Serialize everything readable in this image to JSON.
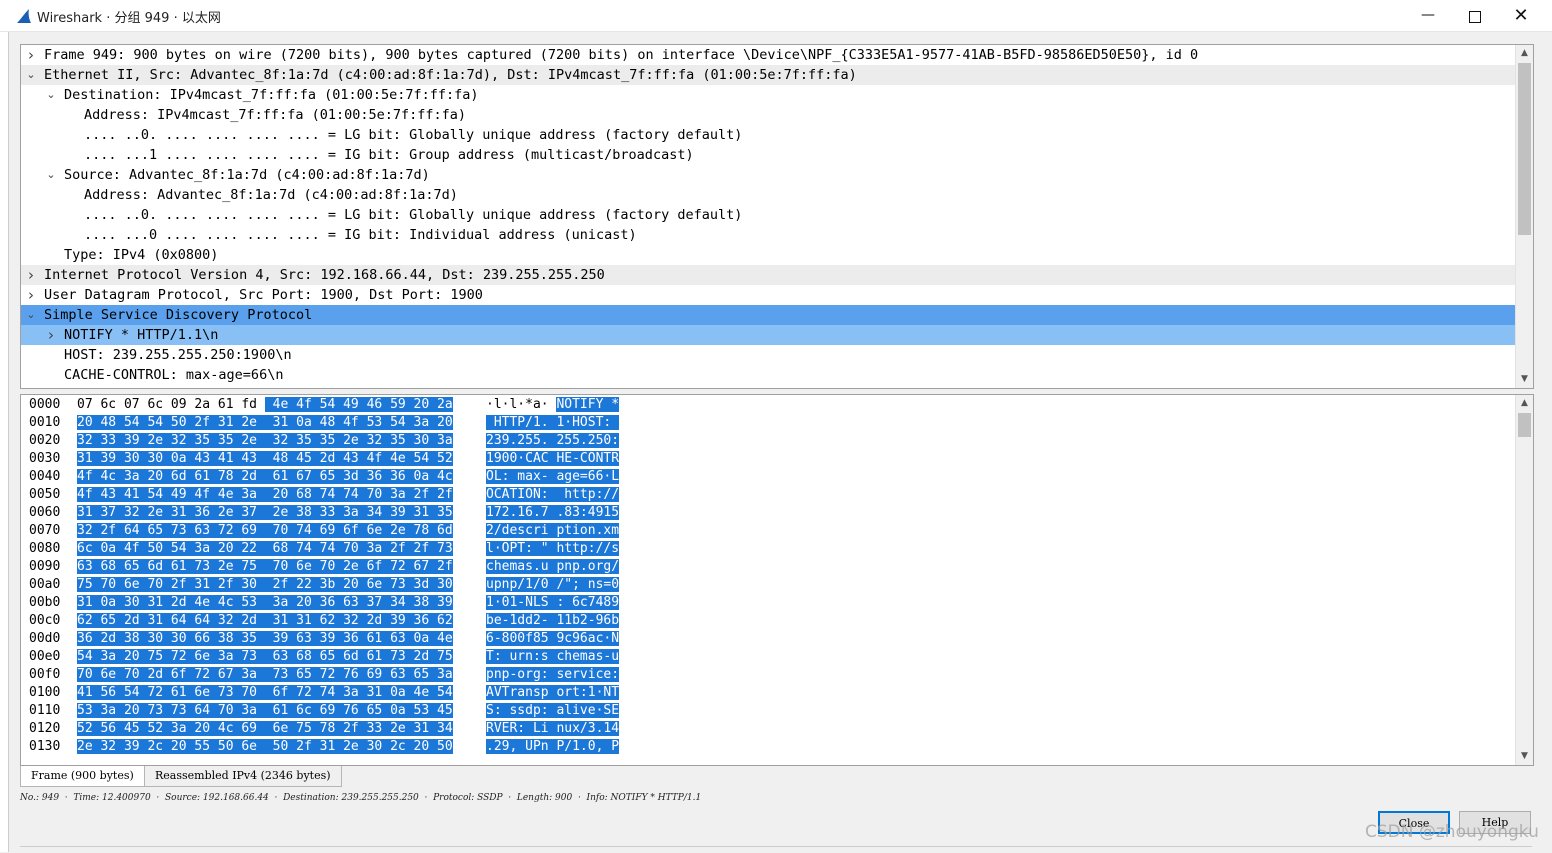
{
  "window": {
    "title": "Wireshark · 分组 949 · 以太网",
    "minimize": "—",
    "close": "✕"
  },
  "tree": {
    "rows": [
      {
        "indent": 0,
        "arrow": "right",
        "text": "Frame 949: 900 bytes on wire (7200 bits), 900 bytes captured (7200 bits) on interface \\Device\\NPF_{C333E5A1-9577-41AB-B5FD-98586ED50E50}, id 0",
        "style": ""
      },
      {
        "indent": 0,
        "arrow": "down",
        "text": "Ethernet II, Src: Advantec_8f:1a:7d (c4:00:ad:8f:1a:7d), Dst: IPv4mcast_7f:ff:fa (01:00:5e:7f:ff:fa)",
        "style": "shade"
      },
      {
        "indent": 1,
        "arrow": "down",
        "text": "Destination: IPv4mcast_7f:ff:fa (01:00:5e:7f:ff:fa)",
        "style": ""
      },
      {
        "indent": 2,
        "arrow": "",
        "text": "Address: IPv4mcast_7f:ff:fa (01:00:5e:7f:ff:fa)",
        "style": ""
      },
      {
        "indent": 2,
        "arrow": "",
        "text": ".... ..0. .... .... .... .... = LG bit: Globally unique address (factory default)",
        "style": ""
      },
      {
        "indent": 2,
        "arrow": "",
        "text": ".... ...1 .... .... .... .... = IG bit: Group address (multicast/broadcast)",
        "style": ""
      },
      {
        "indent": 1,
        "arrow": "down",
        "text": "Source: Advantec_8f:1a:7d (c4:00:ad:8f:1a:7d)",
        "style": ""
      },
      {
        "indent": 2,
        "arrow": "",
        "text": "Address: Advantec_8f:1a:7d (c4:00:ad:8f:1a:7d)",
        "style": ""
      },
      {
        "indent": 2,
        "arrow": "",
        "text": ".... ..0. .... .... .... .... = LG bit: Globally unique address (factory default)",
        "style": ""
      },
      {
        "indent": 2,
        "arrow": "",
        "text": ".... ...0 .... .... .... .... = IG bit: Individual address (unicast)",
        "style": ""
      },
      {
        "indent": 1,
        "arrow": "",
        "text": "Type: IPv4 (0x0800)",
        "style": ""
      },
      {
        "indent": 0,
        "arrow": "right",
        "text": "Internet Protocol Version 4, Src: 192.168.66.44, Dst: 239.255.255.250",
        "style": "shade"
      },
      {
        "indent": 0,
        "arrow": "right",
        "text": "User Datagram Protocol, Src Port: 1900, Dst Port: 1900",
        "style": ""
      },
      {
        "indent": 0,
        "arrow": "down",
        "text": "Simple Service Discovery Protocol",
        "style": "sel"
      },
      {
        "indent": 1,
        "arrow": "right",
        "text": "NOTIFY * HTTP/1.1\\n",
        "style": "sel2"
      },
      {
        "indent": 1,
        "arrow": "",
        "text": "HOST: 239.255.255.250:1900\\n",
        "style": ""
      },
      {
        "indent": 1,
        "arrow": "",
        "text": "CACHE-CONTROL: max-age=66\\n",
        "style": ""
      }
    ]
  },
  "bytes": {
    "rows": [
      {
        "off": "0000",
        "hex": "07 6c 07 6c 09 2a 61 fd  4e 4f 54 49 46 59 20 2a",
        "ascii": "·l·l·*a· NOTIFY *",
        "hexsplit": 24,
        "ascsplit": 9
      },
      {
        "off": "0010",
        "hex": "20 48 54 54 50 2f 31 2e  31 0a 48 4f 53 54 3a 20",
        "ascii": " HTTP/1. 1·HOST: ",
        "hexsplit": 0,
        "ascsplit": 0
      },
      {
        "off": "0020",
        "hex": "32 33 39 2e 32 35 35 2e  32 35 35 2e 32 35 30 3a",
        "ascii": "239.255. 255.250:",
        "hexsplit": 0,
        "ascsplit": 0
      },
      {
        "off": "0030",
        "hex": "31 39 30 30 0a 43 41 43  48 45 2d 43 4f 4e 54 52",
        "ascii": "1900·CAC HE-CONTR",
        "hexsplit": 0,
        "ascsplit": 0
      },
      {
        "off": "0040",
        "hex": "4f 4c 3a 20 6d 61 78 2d  61 67 65 3d 36 36 0a 4c",
        "ascii": "OL: max- age=66·L",
        "hexsplit": 0,
        "ascsplit": 0
      },
      {
        "off": "0050",
        "hex": "4f 43 41 54 49 4f 4e 3a  20 68 74 74 70 3a 2f 2f",
        "ascii": "OCATION:  http://",
        "hexsplit": 0,
        "ascsplit": 0
      },
      {
        "off": "0060",
        "hex": "31 37 32 2e 31 36 2e 37  2e 38 33 3a 34 39 31 35",
        "ascii": "172.16.7 .83:4915",
        "hexsplit": 0,
        "ascsplit": 0
      },
      {
        "off": "0070",
        "hex": "32 2f 64 65 73 63 72 69  70 74 69 6f 6e 2e 78 6d",
        "ascii": "2/descri ption.xm",
        "hexsplit": 0,
        "ascsplit": 0
      },
      {
        "off": "0080",
        "hex": "6c 0a 4f 50 54 3a 20 22  68 74 74 70 3a 2f 2f 73",
        "ascii": "l·OPT: \" http://s",
        "hexsplit": 0,
        "ascsplit": 0
      },
      {
        "off": "0090",
        "hex": "63 68 65 6d 61 73 2e 75  70 6e 70 2e 6f 72 67 2f",
        "ascii": "chemas.u pnp.org/",
        "hexsplit": 0,
        "ascsplit": 0
      },
      {
        "off": "00a0",
        "hex": "75 70 6e 70 2f 31 2f 30  2f 22 3b 20 6e 73 3d 30",
        "ascii": "upnp/1/0 /\"; ns=0",
        "hexsplit": 0,
        "ascsplit": 0
      },
      {
        "off": "00b0",
        "hex": "31 0a 30 31 2d 4e 4c 53  3a 20 36 63 37 34 38 39",
        "ascii": "1·01-NLS : 6c7489",
        "hexsplit": 0,
        "ascsplit": 0
      },
      {
        "off": "00c0",
        "hex": "62 65 2d 31 64 64 32 2d  31 31 62 32 2d 39 36 62",
        "ascii": "be-1dd2- 11b2-96b",
        "hexsplit": 0,
        "ascsplit": 0
      },
      {
        "off": "00d0",
        "hex": "36 2d 38 30 30 66 38 35  39 63 39 36 61 63 0a 4e",
        "ascii": "6-800f85 9c96ac·N",
        "hexsplit": 0,
        "ascsplit": 0
      },
      {
        "off": "00e0",
        "hex": "54 3a 20 75 72 6e 3a 73  63 68 65 6d 61 73 2d 75",
        "ascii": "T: urn:s chemas-u",
        "hexsplit": 0,
        "ascsplit": 0
      },
      {
        "off": "00f0",
        "hex": "70 6e 70 2d 6f 72 67 3a  73 65 72 76 69 63 65 3a",
        "ascii": "pnp-org: service:",
        "hexsplit": 0,
        "ascsplit": 0
      },
      {
        "off": "0100",
        "hex": "41 56 54 72 61 6e 73 70  6f 72 74 3a 31 0a 4e 54",
        "ascii": "AVTransp ort:1·NT",
        "hexsplit": 0,
        "ascsplit": 0
      },
      {
        "off": "0110",
        "hex": "53 3a 20 73 73 64 70 3a  61 6c 69 76 65 0a 53 45",
        "ascii": "S: ssdp: alive·SE",
        "hexsplit": 0,
        "ascsplit": 0
      },
      {
        "off": "0120",
        "hex": "52 56 45 52 3a 20 4c 69  6e 75 78 2f 33 2e 31 34",
        "ascii": "RVER: Li nux/3.14",
        "hexsplit": 0,
        "ascsplit": 0
      },
      {
        "off": "0130",
        "hex": "2e 32 39 2c 20 55 50 6e  50 2f 31 2e 30 2c 20 50",
        "ascii": ".29, UPn P/1.0, P",
        "hexsplit": 0,
        "ascsplit": 0
      }
    ]
  },
  "tabs": [
    {
      "label": "Frame (900 bytes)",
      "active": true
    },
    {
      "label": "Reassembled IPv4 (2346 bytes)",
      "active": false
    }
  ],
  "status": "No.: 949  ·  Time: 12.400970  ·  Source: 192.168.66.44  ·  Destination: 239.255.255.250  ·  Protocol: SSDP  ·  Length: 900  ·  Info: NOTIFY * HTTP/1.1",
  "buttons": {
    "close": "Close",
    "help": "Help"
  },
  "watermark": "CSDN @zhouyongku",
  "colors": {
    "selected_row": "#5aa0ec",
    "highlight_bytes": "#1c78d8",
    "shark_fin": "#1a5fb4"
  }
}
